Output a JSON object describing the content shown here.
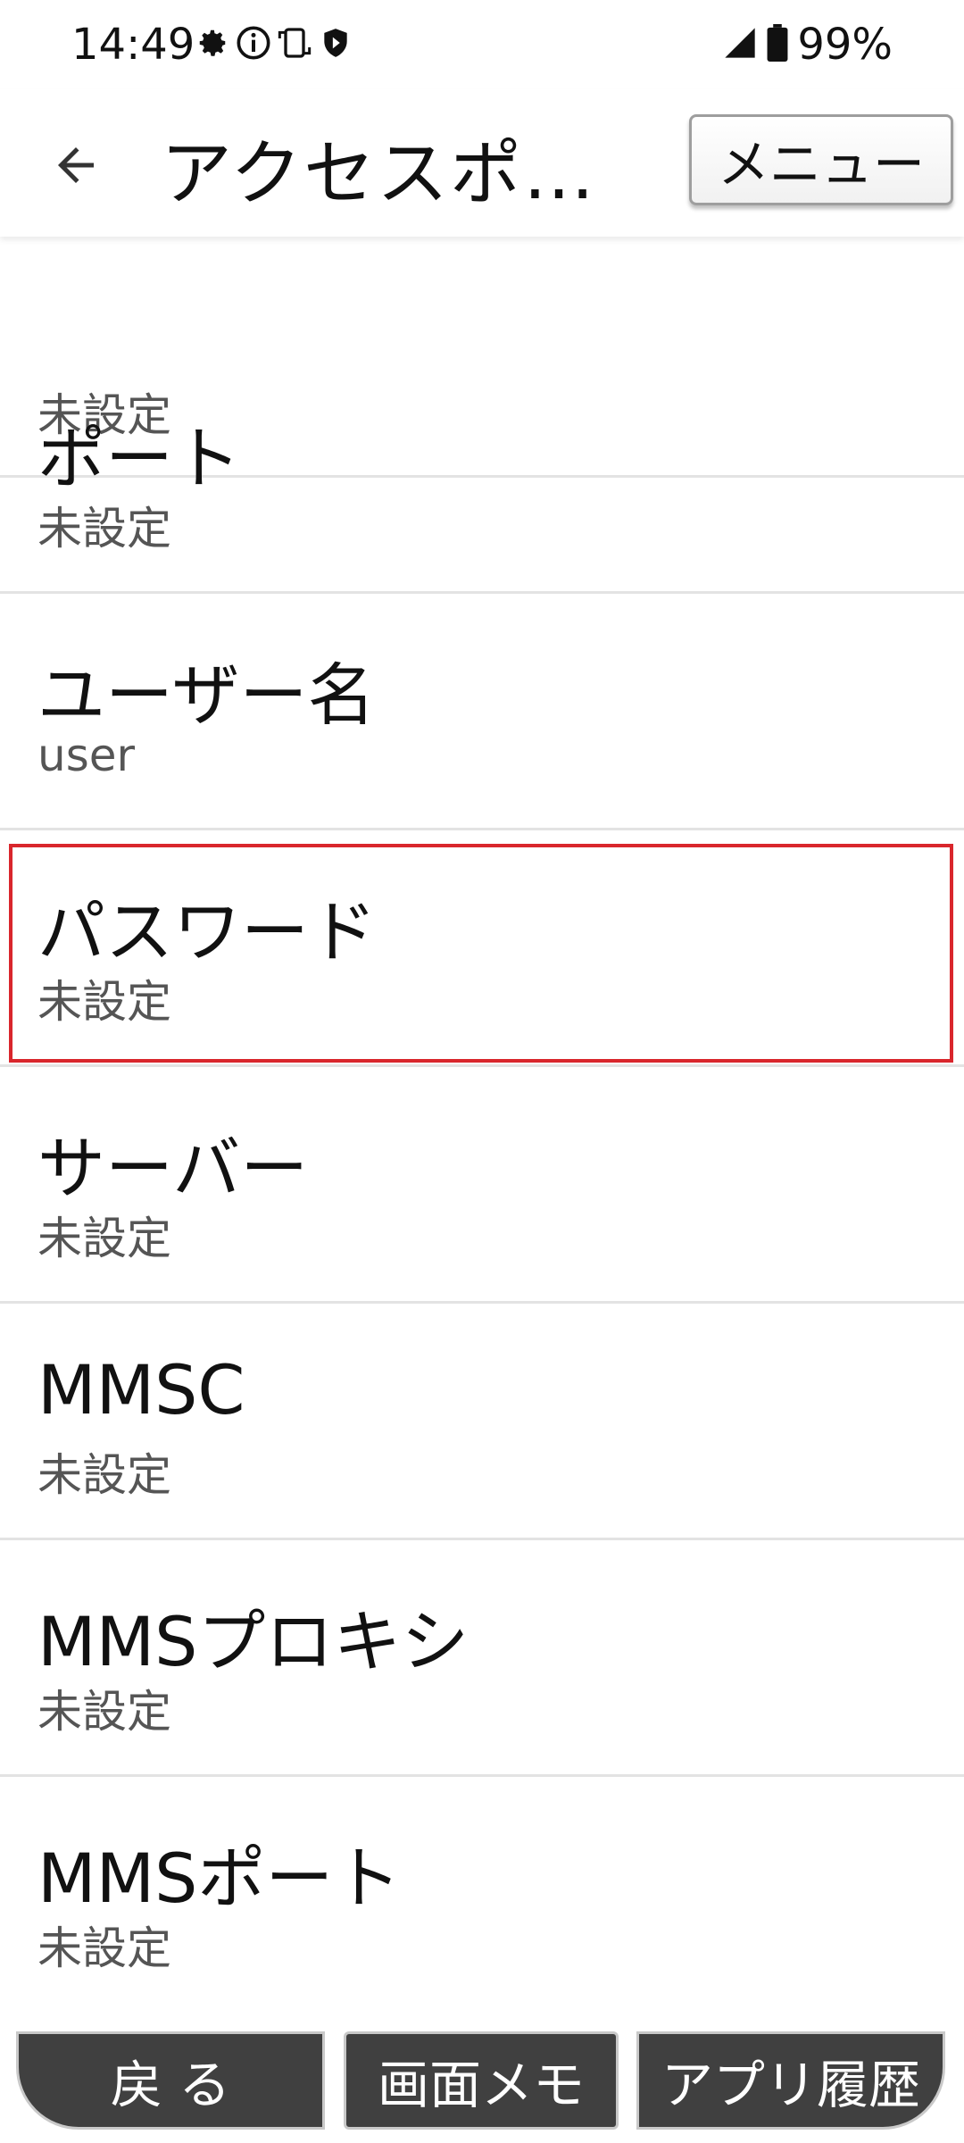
{
  "status_bar": {
    "time": "14:49",
    "battery": "99%",
    "left_icons": [
      "gear-icon",
      "info-icon",
      "screen-rotate-icon",
      "shield-icon"
    ],
    "right_icons": [
      "signal-icon",
      "battery-icon"
    ]
  },
  "app_bar": {
    "title": "アクセスポイ…",
    "menu_label": "メニュー"
  },
  "list": {
    "items": [
      {
        "title": "",
        "subtitle": "未設定"
      },
      {
        "title": "ポート",
        "subtitle": "未設定"
      },
      {
        "title": "ユーザー名",
        "subtitle": "user"
      },
      {
        "title": "パスワード",
        "subtitle": "未設定"
      },
      {
        "title": "サーバー",
        "subtitle": "未設定"
      },
      {
        "title": "MMSC",
        "subtitle": "未設定"
      },
      {
        "title": "MMSプロキシ",
        "subtitle": "未設定"
      },
      {
        "title": "MMSポート",
        "subtitle": "未設定"
      }
    ]
  },
  "bottom_nav": {
    "back_label": "戻 る",
    "memo_label": "画面メモ",
    "history_label": "アプリ履歴"
  },
  "colors": {
    "highlight": "#d9262c",
    "nav_bg": "#404040"
  }
}
